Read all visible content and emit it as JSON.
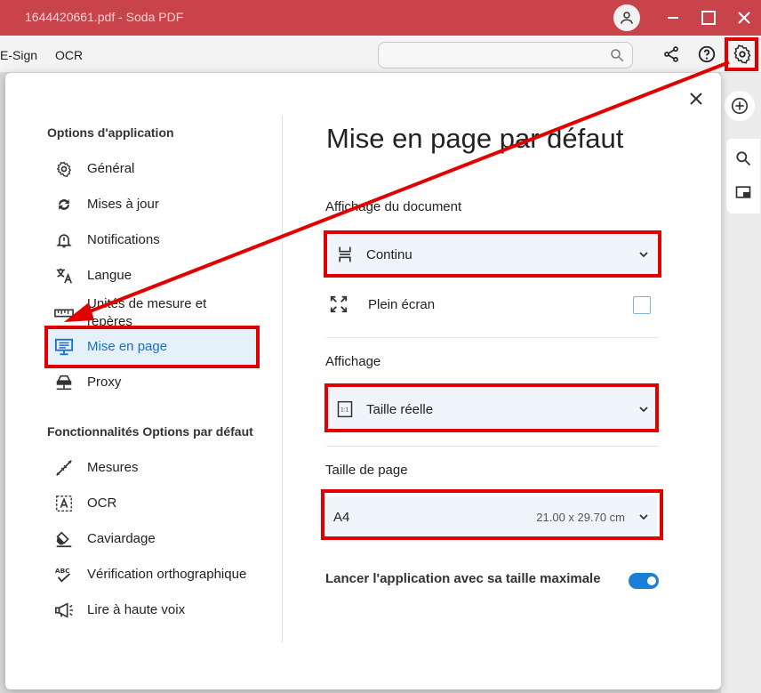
{
  "window": {
    "title": "1644420661.pdf   -   Soda PDF"
  },
  "toolbar": {
    "tabs": [
      "E-Sign",
      "OCR"
    ],
    "search_placeholder": ""
  },
  "dialog": {
    "nav": {
      "section1_title": "Options d'application",
      "items1": [
        {
          "label": "Général",
          "icon": "gear-icon"
        },
        {
          "label": "Mises à jour",
          "icon": "sync-icon"
        },
        {
          "label": "Notifications",
          "icon": "bell-icon"
        },
        {
          "label": "Langue",
          "icon": "translate-icon"
        },
        {
          "label": "Unités de mesure et repères",
          "icon": "ruler-icon"
        },
        {
          "label": "Mise en page",
          "icon": "layout-icon"
        },
        {
          "label": "Proxy",
          "icon": "proxy-icon"
        }
      ],
      "section2_title": "Fonctionnalités Options par défaut",
      "items2": [
        {
          "label": "Mesures",
          "icon": "measure-icon"
        },
        {
          "label": "OCR",
          "icon": "ocr-icon"
        },
        {
          "label": "Caviardage",
          "icon": "eraser-icon"
        },
        {
          "label": "Vérification orthographique",
          "icon": "spellcheck-icon"
        },
        {
          "label": "Lire à haute voix",
          "icon": "megaphone-icon"
        }
      ],
      "active_item": "Mise en page"
    },
    "content": {
      "title": "Mise en page par défaut",
      "document_display": {
        "label": "Affichage du document",
        "value": "Continu",
        "fullscreen_label": "Plein écran",
        "fullscreen_checked": false
      },
      "display": {
        "label": "Affichage",
        "value": "Taille réelle"
      },
      "page_size": {
        "label": "Taille de page",
        "value": "A4",
        "dimensions": "21.00 x 29.70 cm"
      },
      "launch_max": {
        "label": "Lancer l'application avec sa taille maximale",
        "enabled": true
      }
    }
  },
  "colors": {
    "titlebar": "#c8434a",
    "accent": "#1a7fd6",
    "highlight": "#e10000"
  }
}
